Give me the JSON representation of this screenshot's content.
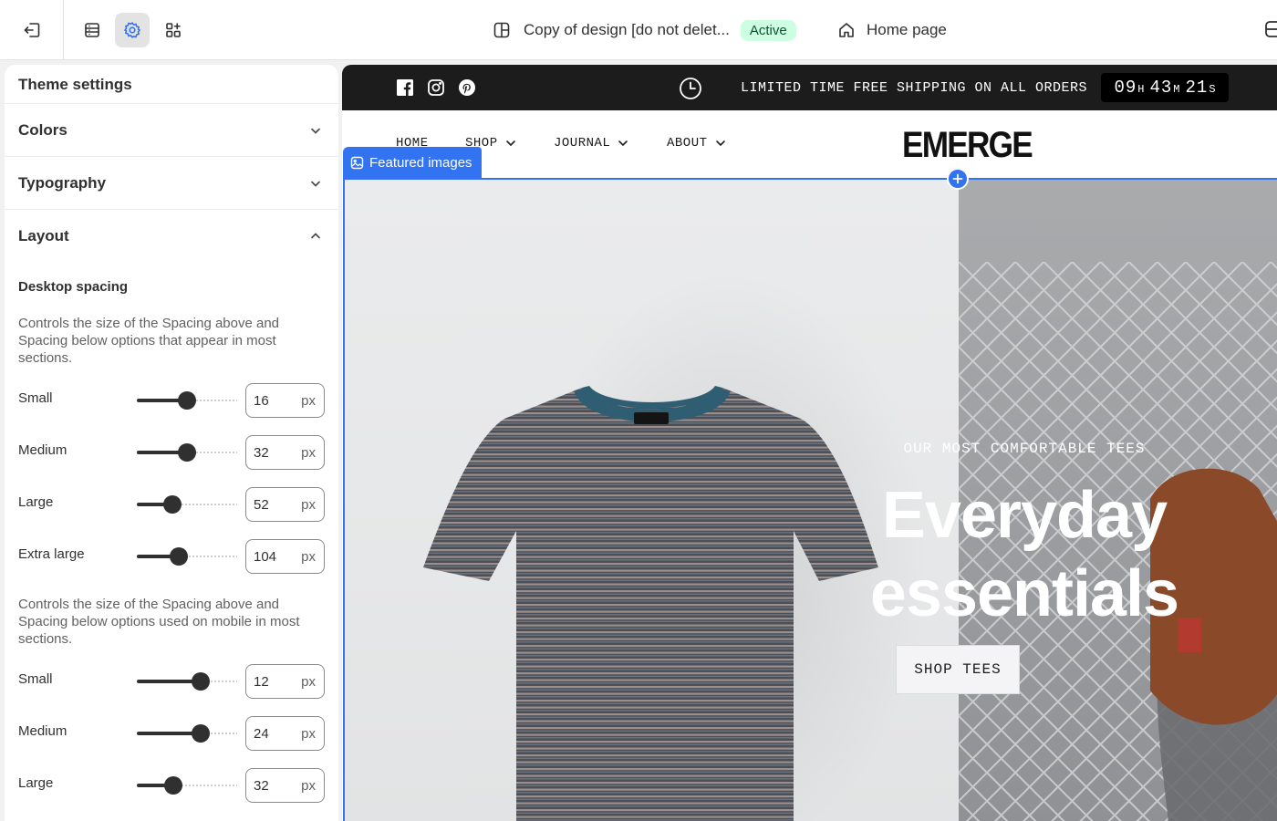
{
  "topbar": {
    "design_name": "Copy of design [do not delet...",
    "status_badge": "Active",
    "page_selector": "Home page"
  },
  "sidebar": {
    "title": "Theme settings",
    "sections": {
      "colors": "Colors",
      "typography": "Typography",
      "layout": "Layout"
    },
    "layout": {
      "heading": "Desktop spacing",
      "desktop_description": "Controls the size of the Spacing above and Spacing below options that appear in most sections.",
      "desktop": [
        {
          "label": "Small",
          "value": "16",
          "unit": "px",
          "level": 0.5
        },
        {
          "label": "Medium",
          "value": "32",
          "unit": "px",
          "level": 0.5
        },
        {
          "label": "Large",
          "value": "52",
          "unit": "px",
          "level": 0.35
        },
        {
          "label": "Extra large",
          "value": "104",
          "unit": "px",
          "level": 0.42
        }
      ],
      "mobile_description": "Controls the size of the Spacing above and Spacing below options used on mobile in most sections.",
      "mobile": [
        {
          "label": "Small",
          "value": "12",
          "unit": "px",
          "level": 0.64
        },
        {
          "label": "Medium",
          "value": "24",
          "unit": "px",
          "level": 0.64
        },
        {
          "label": "Large",
          "value": "32",
          "unit": "px",
          "level": 0.36
        }
      ]
    }
  },
  "preview": {
    "announcement": "LIMITED TIME FREE SHIPPING ON ALL ORDERS",
    "countdown": {
      "hours": "09",
      "hours_unit": "H",
      "minutes": "43",
      "minutes_unit": "M",
      "seconds": "21",
      "seconds_unit": "S"
    },
    "nav": [
      "HOME",
      "SHOP",
      "JOURNAL",
      "ABOUT"
    ],
    "brand": "EMERGE",
    "section_tag": "Featured images",
    "hero": {
      "kicker": "OUR MOST COMFORTABLE TEES",
      "headline_line1": "Everyday",
      "headline_line2": "essentials",
      "button": "SHOP TEES"
    }
  },
  "colors": {
    "accent": "#3173f0",
    "active_badge_bg": "#cdfee1",
    "announcement_bg": "#1c1c1c"
  }
}
